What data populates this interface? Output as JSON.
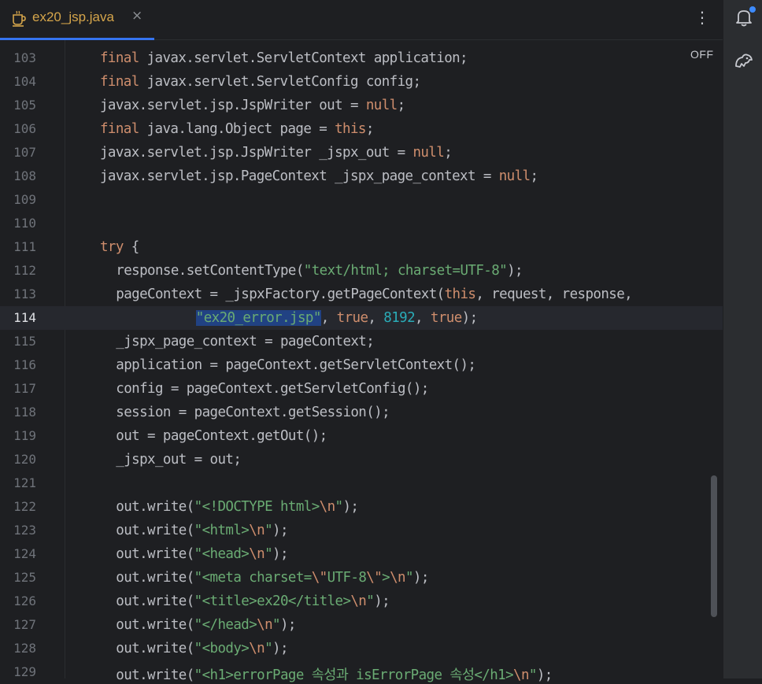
{
  "tab": {
    "label": "ex20_jsp.java",
    "close": "×"
  },
  "menu_icon": "⋮",
  "inspection_status": "OFF",
  "icons": {
    "file": "java-coffee-icon",
    "notifications": "bell-icon",
    "assistant": "ai-assistant-icon"
  },
  "colors": {
    "keyword": "#cf8e6d",
    "string": "#6aab73",
    "number": "#2aacb8",
    "default": "#bcbec4",
    "selection": "#214283",
    "accent": "#3574f0"
  },
  "current_line": "114",
  "lines": [
    {
      "n": "103",
      "indent": 0,
      "segs": [
        {
          "t": "final",
          "c": "kw"
        },
        {
          "t": " javax.servlet.ServletContext application;",
          "c": ""
        }
      ]
    },
    {
      "n": "104",
      "indent": 0,
      "segs": [
        {
          "t": "final",
          "c": "kw"
        },
        {
          "t": " javax.servlet.ServletConfig config;",
          "c": ""
        }
      ]
    },
    {
      "n": "105",
      "indent": 0,
      "segs": [
        {
          "t": "javax.servlet.jsp.JspWriter out = ",
          "c": ""
        },
        {
          "t": "null",
          "c": "kw"
        },
        {
          "t": ";",
          "c": ""
        }
      ]
    },
    {
      "n": "106",
      "indent": 0,
      "segs": [
        {
          "t": "final",
          "c": "kw"
        },
        {
          "t": " java.lang.Object page = ",
          "c": ""
        },
        {
          "t": "this",
          "c": "kw"
        },
        {
          "t": ";",
          "c": ""
        }
      ]
    },
    {
      "n": "107",
      "indent": 0,
      "segs": [
        {
          "t": "javax.servlet.jsp.JspWriter _jspx_out = ",
          "c": ""
        },
        {
          "t": "null",
          "c": "kw"
        },
        {
          "t": ";",
          "c": ""
        }
      ]
    },
    {
      "n": "108",
      "indent": 0,
      "segs": [
        {
          "t": "javax.servlet.jsp.PageContext _jspx_page_context = ",
          "c": ""
        },
        {
          "t": "null",
          "c": "kw"
        },
        {
          "t": ";",
          "c": ""
        }
      ]
    },
    {
      "n": "109",
      "indent": 0,
      "segs": []
    },
    {
      "n": "110",
      "indent": 0,
      "segs": []
    },
    {
      "n": "111",
      "indent": 0,
      "segs": [
        {
          "t": "try",
          "c": "kw"
        },
        {
          "t": " {",
          "c": ""
        }
      ]
    },
    {
      "n": "112",
      "indent": 1,
      "segs": [
        {
          "t": "response.setContentType(",
          "c": ""
        },
        {
          "t": "\"text/html; charset=UTF-8\"",
          "c": "str"
        },
        {
          "t": ");",
          "c": ""
        }
      ]
    },
    {
      "n": "113",
      "indent": 1,
      "segs": [
        {
          "t": "pageContext = _jspxFactory.getPageContext(",
          "c": ""
        },
        {
          "t": "this",
          "c": "kw"
        },
        {
          "t": ", request, response,",
          "c": ""
        }
      ]
    },
    {
      "n": "114",
      "indent": 6,
      "segs": [
        {
          "t": "\"ex20_error.jsp\"",
          "c": "str sel"
        },
        {
          "t": ", ",
          "c": ""
        },
        {
          "t": "true",
          "c": "kw"
        },
        {
          "t": ", ",
          "c": ""
        },
        {
          "t": "8192",
          "c": "num"
        },
        {
          "t": ", ",
          "c": ""
        },
        {
          "t": "true",
          "c": "kw"
        },
        {
          "t": ");",
          "c": ""
        }
      ]
    },
    {
      "n": "115",
      "indent": 1,
      "segs": [
        {
          "t": "_jspx_page_context = pageContext;",
          "c": ""
        }
      ]
    },
    {
      "n": "116",
      "indent": 1,
      "segs": [
        {
          "t": "application = pageContext.getServletContext();",
          "c": ""
        }
      ]
    },
    {
      "n": "117",
      "indent": 1,
      "segs": [
        {
          "t": "config = pageContext.getServletConfig();",
          "c": ""
        }
      ]
    },
    {
      "n": "118",
      "indent": 1,
      "segs": [
        {
          "t": "session = pageContext.getSession();",
          "c": ""
        }
      ]
    },
    {
      "n": "119",
      "indent": 1,
      "segs": [
        {
          "t": "out = pageContext.getOut();",
          "c": ""
        }
      ]
    },
    {
      "n": "120",
      "indent": 1,
      "segs": [
        {
          "t": "_jspx_out = out;",
          "c": ""
        }
      ]
    },
    {
      "n": "121",
      "indent": 0,
      "segs": []
    },
    {
      "n": "122",
      "indent": 1,
      "segs": [
        {
          "t": "out.write(",
          "c": ""
        },
        {
          "t": "\"<!DOCTYPE html>",
          "c": "str"
        },
        {
          "t": "\\n",
          "c": "esc"
        },
        {
          "t": "\"",
          "c": "str"
        },
        {
          "t": ");",
          "c": ""
        }
      ]
    },
    {
      "n": "123",
      "indent": 1,
      "segs": [
        {
          "t": "out.write(",
          "c": ""
        },
        {
          "t": "\"<html>",
          "c": "str"
        },
        {
          "t": "\\n",
          "c": "esc"
        },
        {
          "t": "\"",
          "c": "str"
        },
        {
          "t": ");",
          "c": ""
        }
      ]
    },
    {
      "n": "124",
      "indent": 1,
      "segs": [
        {
          "t": "out.write(",
          "c": ""
        },
        {
          "t": "\"<head>",
          "c": "str"
        },
        {
          "t": "\\n",
          "c": "esc"
        },
        {
          "t": "\"",
          "c": "str"
        },
        {
          "t": ");",
          "c": ""
        }
      ]
    },
    {
      "n": "125",
      "indent": 1,
      "segs": [
        {
          "t": "out.write(",
          "c": ""
        },
        {
          "t": "\"<meta charset=",
          "c": "str"
        },
        {
          "t": "\\\"",
          "c": "esc"
        },
        {
          "t": "UTF-8",
          "c": "str"
        },
        {
          "t": "\\\"",
          "c": "esc"
        },
        {
          "t": ">",
          "c": "str"
        },
        {
          "t": "\\n",
          "c": "esc"
        },
        {
          "t": "\"",
          "c": "str"
        },
        {
          "t": ");",
          "c": ""
        }
      ]
    },
    {
      "n": "126",
      "indent": 1,
      "segs": [
        {
          "t": "out.write(",
          "c": ""
        },
        {
          "t": "\"<title>ex20</title>",
          "c": "str"
        },
        {
          "t": "\\n",
          "c": "esc"
        },
        {
          "t": "\"",
          "c": "str"
        },
        {
          "t": ");",
          "c": ""
        }
      ]
    },
    {
      "n": "127",
      "indent": 1,
      "segs": [
        {
          "t": "out.write(",
          "c": ""
        },
        {
          "t": "\"</head>",
          "c": "str"
        },
        {
          "t": "\\n",
          "c": "esc"
        },
        {
          "t": "\"",
          "c": "str"
        },
        {
          "t": ");",
          "c": ""
        }
      ]
    },
    {
      "n": "128",
      "indent": 1,
      "segs": [
        {
          "t": "out.write(",
          "c": ""
        },
        {
          "t": "\"<body>",
          "c": "str"
        },
        {
          "t": "\\n",
          "c": "esc"
        },
        {
          "t": "\"",
          "c": "str"
        },
        {
          "t": ");",
          "c": ""
        }
      ]
    },
    {
      "n": "129",
      "indent": 1,
      "segs": [
        {
          "t": "out.write(",
          "c": ""
        },
        {
          "t": "\"<h1>errorPage 속성과 isErrorPage 속성</h1>",
          "c": "str"
        },
        {
          "t": "\\n",
          "c": "esc"
        },
        {
          "t": "\"",
          "c": "str"
        },
        {
          "t": ");",
          "c": ""
        }
      ]
    }
  ]
}
